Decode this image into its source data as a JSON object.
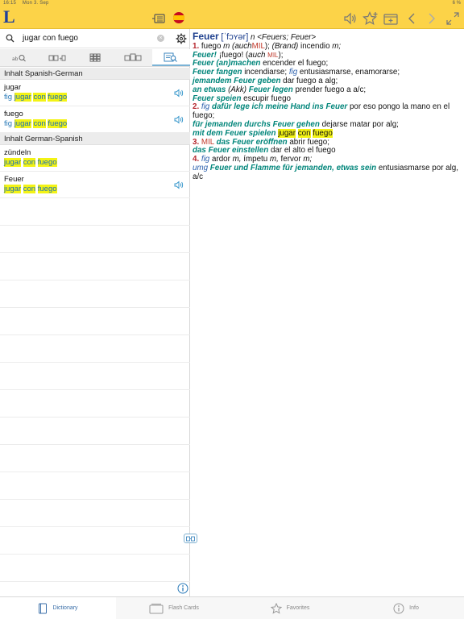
{
  "status": {
    "time": "16:15",
    "date": "Mon 3. Sep",
    "battery": "6 %"
  },
  "app": {
    "logo": "L"
  },
  "search": {
    "query": "jugar con fuego",
    "clear": "×"
  },
  "sections": [
    {
      "title": "Inhalt Spanish-German",
      "rows": [
        {
          "term": "jugar",
          "prefix": "fig",
          "w1": "jugar",
          "w2": "con",
          "w3": "fuego",
          "audio": true
        },
        {
          "term": "fuego",
          "prefix": "fig",
          "w1": "jugar",
          "w2": "con",
          "w3": "fuego",
          "audio": true
        }
      ]
    },
    {
      "title": "Inhalt German-Spanish",
      "rows": [
        {
          "term": "zündeln",
          "prefix": "",
          "w1": "jugar",
          "w2": "con",
          "w3": "fuego",
          "audio": false
        },
        {
          "term": "Feuer",
          "prefix": "",
          "w1": "jugar",
          "w2": "con",
          "w3": "fuego",
          "audio": true
        }
      ]
    }
  ],
  "entry": {
    "headword": "Feuer",
    "pron": "[ˈfɔʏər]",
    "grammar_n": "n",
    "grammar_forms": "<Feuers; Feuer>",
    "line1_num": "1.",
    "line1_a": "fuego",
    "line1_b": "m (auch",
    "line1_mil": "MIL",
    "line1_c": ");",
    "line1_d": "(Brand)",
    "line1_e": "incendio",
    "line1_f": "m;",
    "l2_ex": "Feuer!",
    "l2_t": "¡fuego! (",
    "l2_auch": "auch",
    "l2_mil": "MIL",
    "l2_end": ");",
    "l3_ex": "Feuer (an)machen",
    "l3_t": "encender el fuego;",
    "l4_ex": "Feuer fangen",
    "l4_t": "incendiarse;",
    "l4_fig": "fig",
    "l4_t2": "entusiasmarse, enamorarse;",
    "l5_ex": "jemandem Feuer geben",
    "l5_t": "dar fuego a alg;",
    "l6_ex": "an etwas",
    "l6_akk": "(Akk)",
    "l6_ex2": "Feuer legen",
    "l6_t": "prender fuego a a/c;",
    "l7_ex": "Feuer speien",
    "l7_t": "escupir fuego",
    "l8_num": "2.",
    "l8_fig": "fig",
    "l8_ex": "dafür lege ich meine Hand ins Feuer",
    "l8_t": "por eso pongo la mano en el fuego;",
    "l9_ex": "für jemanden durchs Feuer gehen",
    "l9_t": "dejarse matar por alg;",
    "l10_ex": "mit dem Feuer spielen",
    "l10_w1": "jugar",
    "l10_w2": "con",
    "l10_w3": "fuego",
    "l11_num": "3.",
    "l11_mil": "MIL",
    "l11_ex": "das Feuer eröffnen",
    "l11_t": "abrir fuego;",
    "l12_ex": "das Feuer einstellen",
    "l12_t": "dar el alto el fuego",
    "l13_num": "4.",
    "l13_fig": "fig",
    "l13_t": "ardor",
    "l13_m1": "m,",
    "l13_t2": "ímpetu",
    "l13_m2": "m,",
    "l13_t3": "fervor",
    "l13_m3": "m;",
    "l14_umg": "umg",
    "l14_ex": "Feuer und Flamme für jemanden, etwas sein",
    "l14_t": "entusiasmarse por alg, a/c"
  },
  "tabs": [
    {
      "label": "Dictionary",
      "icon": "book-icon",
      "active": true
    },
    {
      "label": "Flash Cards",
      "icon": "cards-icon",
      "active": false
    },
    {
      "label": "Favorites",
      "icon": "star-icon",
      "active": false
    },
    {
      "label": "Info",
      "icon": "info-icon",
      "active": false
    }
  ],
  "colors": {
    "toolbar": "#fcd348",
    "accent": "#2a7ab8",
    "highlight": "#f3f315",
    "headword": "#1d3f8e",
    "example": "#00857a"
  }
}
